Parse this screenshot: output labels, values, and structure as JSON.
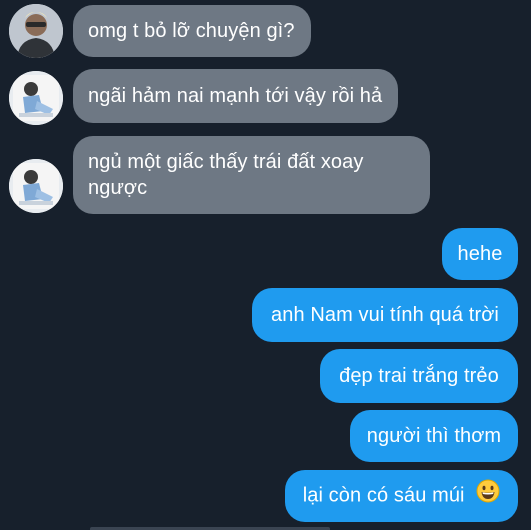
{
  "conversation": {
    "incoming": [
      {
        "text": "omg t bỏ lỡ chuyện gì?",
        "avatar": "avatar-icon"
      },
      {
        "text": "ngãi hảm nai mạnh tới vậy rồi hả",
        "avatar": "avatar-icon"
      },
      {
        "text": "ngủ một giấc thấy trái đất xoay ngược",
        "avatar": "avatar-icon"
      }
    ],
    "outgoing": [
      {
        "text": "hehe"
      },
      {
        "text": "anh Nam vui tính quá trời"
      },
      {
        "text": "đẹp trai trắng trẻo"
      },
      {
        "text": "người thì thơm"
      },
      {
        "text": "lại còn có sáu múi",
        "emoji": "grinning-face-icon"
      }
    ]
  },
  "colors": {
    "background": "#17202c",
    "incoming_bubble": "#6e7884",
    "outgoing_bubble": "#1f9bef",
    "text": "#ffffff"
  }
}
